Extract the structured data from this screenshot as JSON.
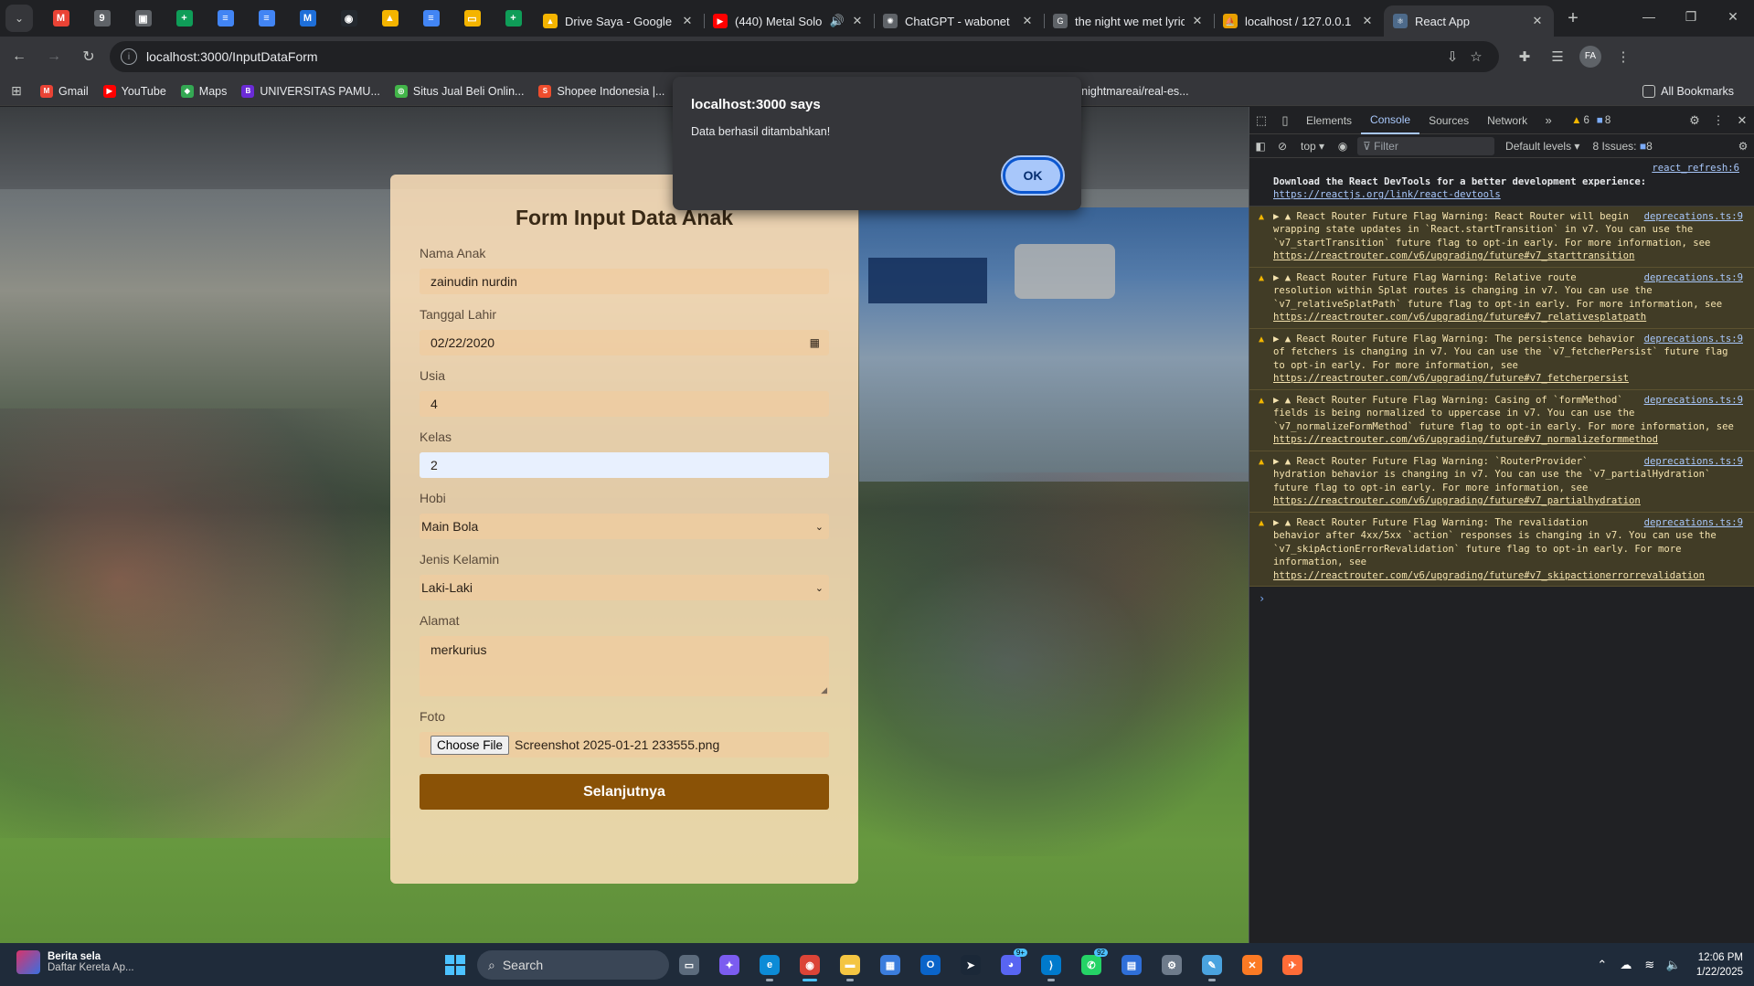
{
  "browser": {
    "pinned_tabs": [
      {
        "icon": "gmail-icon",
        "color": "#ea4335",
        "glyph": "M"
      },
      {
        "icon": "nine-icon",
        "color": "#5f6368",
        "glyph": "9"
      },
      {
        "icon": "photo-icon",
        "color": "#5f6368",
        "glyph": "▣"
      },
      {
        "icon": "sheets-icon",
        "color": "#0f9d58",
        "glyph": "+"
      },
      {
        "icon": "docs-icon",
        "color": "#4285f4",
        "glyph": "≡"
      },
      {
        "icon": "docs-icon",
        "color": "#4285f4",
        "glyph": "≡"
      },
      {
        "icon": "m-icon",
        "color": "#1e6fd9",
        "glyph": "M"
      },
      {
        "icon": "github-icon",
        "color": "#24292f",
        "glyph": "◉"
      },
      {
        "icon": "drive-icon",
        "color": "#f4b400",
        "glyph": "▲"
      },
      {
        "icon": "docs-icon",
        "color": "#4285f4",
        "glyph": "≡"
      },
      {
        "icon": "slides-icon",
        "color": "#f4b400",
        "glyph": "▭"
      },
      {
        "icon": "sheets-icon",
        "color": "#0f9d58",
        "glyph": "+"
      }
    ],
    "tabs": [
      {
        "title": "Drive Saya - Google D",
        "color": "#f4b400",
        "glyph": "▲",
        "icon": "drive-icon"
      },
      {
        "title": "(440) Metal Solo",
        "color": "#ff0000",
        "glyph": "▶",
        "icon": "youtube-icon",
        "audio": "🔊"
      },
      {
        "title": "ChatGPT - wabonet",
        "color": "#5f6368",
        "glyph": "✺",
        "icon": "chatgpt-icon"
      },
      {
        "title": "the night we met lyric",
        "color": "#5f6368",
        "glyph": "G",
        "icon": "google-icon"
      },
      {
        "title": "localhost / 127.0.0.1 /",
        "color": "#e8a000",
        "glyph": "⛵",
        "icon": "phpmyadmin-icon"
      },
      {
        "title": "React App",
        "color": "#4d6a8a",
        "glyph": "⚛",
        "icon": "react-icon"
      }
    ],
    "url": "localhost:3000/InputDataForm",
    "bookmarks": [
      {
        "label": "Gmail",
        "color": "#ea4335",
        "glyph": "M",
        "icon": "gmail-icon"
      },
      {
        "label": "YouTube",
        "color": "#ff0000",
        "glyph": "▶",
        "icon": "youtube-icon"
      },
      {
        "label": "Maps",
        "color": "#34a853",
        "glyph": "◆",
        "icon": "maps-icon"
      },
      {
        "label": "UNIVERSITAS PAMU...",
        "color": "#6b2bd6",
        "glyph": "B",
        "icon": "university-icon"
      },
      {
        "label": "Situs Jual Beli Onlin...",
        "color": "#42b549",
        "glyph": "◎",
        "icon": "tokopedia-icon"
      },
      {
        "label": "Shopee Indonesia |...",
        "color": "#ee4d2d",
        "glyph": "S",
        "icon": "shopee-icon"
      },
      {
        "label": "m Onl...",
        "color": "#5f6368",
        "glyph": "",
        "icon": "bookmark-icon"
      },
      {
        "label": "nightmareai/real-es...",
        "color": "#5f6368",
        "glyph": "▤",
        "icon": "replicate-icon"
      }
    ],
    "all_bookmarks": "All Bookmarks"
  },
  "alert": {
    "title": "localhost:3000 says",
    "message": "Data berhasil ditambahkan!",
    "ok_label": "OK"
  },
  "form": {
    "title": "Form Input Data Anak",
    "fields": {
      "nama": {
        "label": "Nama Anak",
        "value": "zainudin nurdin"
      },
      "tanggal": {
        "label": "Tanggal Lahir",
        "value": "02/22/2020"
      },
      "usia": {
        "label": "Usia",
        "value": "4"
      },
      "kelas": {
        "label": "Kelas",
        "value": "2"
      },
      "hobi": {
        "label": "Hobi",
        "value": "Main Bola"
      },
      "jenis_kelamin": {
        "label": "Jenis Kelamin",
        "value": "Laki-Laki"
      },
      "alamat": {
        "label": "Alamat",
        "value": "merkurius"
      },
      "foto": {
        "label": "Foto",
        "button": "Choose File",
        "value": "Screenshot 2025-01-21 233555.png"
      }
    },
    "submit_label": "Selanjutnya",
    "accent_color": "#8a5206"
  },
  "devtools": {
    "tabs": [
      "Elements",
      "Console",
      "Sources",
      "Network"
    ],
    "active_tab": "Console",
    "warning_count": "6",
    "message_count": "8",
    "context": "top",
    "filter_placeholder": "Filter",
    "levels": "Default levels",
    "issues": "8 Issues:",
    "issues_count": "8",
    "info": {
      "source": "react_refresh:6",
      "text": "Download the React DevTools for a better development experience:",
      "link": "https://reactjs.org/link/react-devtools"
    },
    "warnings": [
      {
        "source": "deprecations.ts:9",
        "text": "React Router Future Flag Warning: React Router will begin wrapping state updates in `React.startTransition` in v7. You can use the `v7_startTransition` future flag to opt-in early. For more information, see",
        "link": "https://reactrouter.com/v6/upgrading/future#v7_starttransition"
      },
      {
        "source": "deprecations.ts:9",
        "text": "React Router Future Flag Warning: Relative route resolution within Splat routes is changing in v7. You can use the `v7_relativeSplatPath` future flag to opt-in early. For more information, see",
        "link": "https://reactrouter.com/v6/upgrading/future#v7_relativesplatpath"
      },
      {
        "source": "deprecations.ts:9",
        "text": "React Router Future Flag Warning: The persistence behavior of fetchers is changing in v7. You can use the `v7_fetcherPersist` future flag to opt-in early. For more information, see",
        "link": "https://reactrouter.com/v6/upgrading/future#v7_fetcherpersist"
      },
      {
        "source": "deprecations.ts:9",
        "text": "React Router Future Flag Warning: Casing of `formMethod` fields is being normalized to uppercase in v7. You can use the `v7_normalizeFormMethod` future flag to opt-in early. For more information, see",
        "link": "https://reactrouter.com/v6/upgrading/future#v7_normalizeformmethod"
      },
      {
        "source": "deprecations.ts:9",
        "text": "React Router Future Flag Warning: `RouterProvider` hydration behavior is changing in v7. You can use the `v7_partialHydration` future flag to opt-in early. For more information, see",
        "link": "https://reactrouter.com/v6/upgrading/future#v7_partialhydration"
      },
      {
        "source": "deprecations.ts:9",
        "text": "React Router Future Flag Warning: The revalidation behavior after 4xx/5xx `action` responses is changing in v7. You can use the `v7_skipActionErrorRevalidation` future flag to opt-in early. For more information, see",
        "link": "https://reactrouter.com/v6/upgrading/future#v7_skipactionerrorrevalidation"
      }
    ]
  },
  "taskbar": {
    "news_title": "Berita sela",
    "news_sub": "Daftar Kereta Ap...",
    "search_label": "Search",
    "apps": [
      {
        "icon": "file-explorer-window-icon",
        "color": "#5c6b7c",
        "glyph": "▭"
      },
      {
        "icon": "copilot-icon",
        "color": "#7b5cf0",
        "glyph": "✦"
      },
      {
        "icon": "edge-icon",
        "color": "#0c8bd6",
        "glyph": "e"
      },
      {
        "icon": "chrome-icon",
        "color": "#db4437",
        "glyph": "◉",
        "active": true
      },
      {
        "icon": "folder-icon",
        "color": "#f4c542",
        "glyph": "▬"
      },
      {
        "icon": "store-icon",
        "color": "#3b7ddd",
        "glyph": "▦"
      },
      {
        "icon": "outlook-icon",
        "color": "#0a64c9",
        "glyph": "O"
      },
      {
        "icon": "steam-icon",
        "color": "#1b2838",
        "glyph": "➤"
      },
      {
        "icon": "discord-icon",
        "color": "#5865f2",
        "glyph": "◕",
        "badge": "9+"
      },
      {
        "icon": "vscode-icon",
        "color": "#007acc",
        "glyph": "⟩"
      },
      {
        "icon": "whatsapp-icon",
        "color": "#25d366",
        "glyph": "✆",
        "badge": "92"
      },
      {
        "icon": "calendar-icon",
        "color": "#2f6fd8",
        "glyph": "▤"
      },
      {
        "icon": "settings-icon",
        "color": "#6e7b8b",
        "glyph": "⚙"
      },
      {
        "icon": "notepad-icon",
        "color": "#4aa3df",
        "glyph": "✎"
      },
      {
        "icon": "xampp-icon",
        "color": "#fb7a24",
        "glyph": "✕"
      },
      {
        "icon": "postman-icon",
        "color": "#ff6c37",
        "glyph": "✈"
      }
    ],
    "time": "12:06 PM",
    "date": "1/22/2025"
  }
}
